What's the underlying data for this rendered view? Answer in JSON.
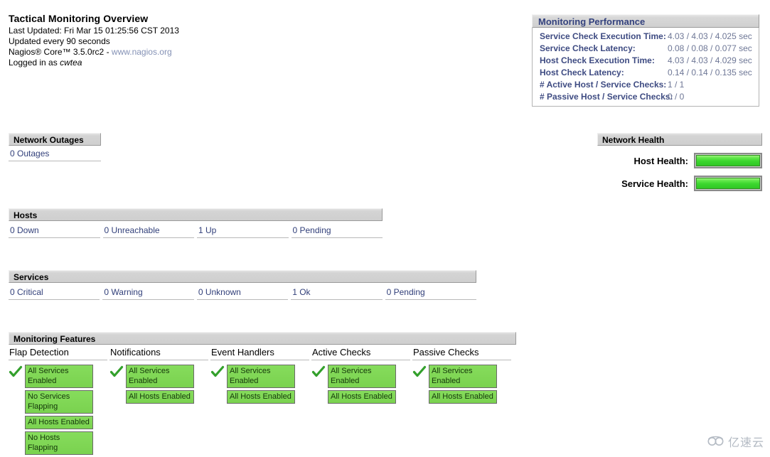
{
  "header": {
    "title": "Tactical Monitoring Overview",
    "last_updated": "Last Updated: Fri Mar 15 01:25:56 CST 2013",
    "update_interval": "Updated every 90 seconds",
    "version_prefix": "Nagios® Core™ 3.5.0rc2 - ",
    "nagios_url": "www.nagios.org",
    "logged_in_prefix": "Logged in as ",
    "logged_in_user": "cwtea"
  },
  "outages": {
    "title": "Network Outages",
    "count_label": "0 Outages"
  },
  "hosts": {
    "title": "Hosts",
    "cells": [
      {
        "label": "0 Down"
      },
      {
        "label": "0 Unreachable"
      },
      {
        "label": "1 Up"
      },
      {
        "label": "0 Pending"
      }
    ]
  },
  "services": {
    "title": "Services",
    "cells": [
      {
        "label": "0 Critical"
      },
      {
        "label": "0 Warning"
      },
      {
        "label": "0 Unknown"
      },
      {
        "label": "1 Ok"
      },
      {
        "label": "0 Pending"
      }
    ]
  },
  "features": {
    "title": "Monitoring Features",
    "columns": [
      {
        "heading": "Flap Detection",
        "icon": "green-check-icon",
        "boxes": [
          "All Services Enabled",
          "No Services Flapping",
          "All Hosts Enabled",
          "No Hosts Flapping"
        ]
      },
      {
        "heading": "Notifications",
        "icon": "green-check-icon",
        "boxes": [
          "All Services Enabled",
          "All Hosts Enabled"
        ]
      },
      {
        "heading": "Event Handlers",
        "icon": "green-check-icon",
        "boxes": [
          "All Services Enabled",
          "All Hosts Enabled"
        ]
      },
      {
        "heading": "Active Checks",
        "icon": "green-check-icon",
        "boxes": [
          "All Services Enabled",
          "All Hosts Enabled"
        ]
      },
      {
        "heading": "Passive Checks",
        "icon": "green-check-icon",
        "boxes": [
          "All Services Enabled",
          "All Hosts Enabled"
        ]
      }
    ]
  },
  "performance": {
    "title": "Monitoring Performance",
    "rows": [
      {
        "label": "Service Check Execution Time:",
        "value": "4.03 / 4.03 / 4.025 sec"
      },
      {
        "label": "Service Check Latency:",
        "value": "0.08 / 0.08 / 0.077 sec"
      },
      {
        "label": "Host Check Execution Time:",
        "value": "4.03 / 4.03 / 4.029 sec"
      },
      {
        "label": "Host Check Latency:",
        "value": "0.14 / 0.14 / 0.135 sec"
      },
      {
        "label": "# Active Host / Service Checks:",
        "value": "1 / 1"
      },
      {
        "label": "# Passive Host / Service Checks:",
        "value": "0 / 0"
      }
    ]
  },
  "health": {
    "title": "Network Health",
    "rows": [
      {
        "label": "Host Health:",
        "percent": 100
      },
      {
        "label": "Service Health:",
        "percent": 100
      }
    ]
  },
  "watermark": {
    "text": "亿速云",
    "icon": "cloud-logo-icon"
  },
  "colors": {
    "link": "#32407a",
    "perf_label": "#3e4b82",
    "perf_value": "#6e7796",
    "panel_title": "#34427e",
    "feature_green": "#7ed957",
    "health_green": "#3bd62e",
    "bar_grey": "#d0d0d0"
  }
}
